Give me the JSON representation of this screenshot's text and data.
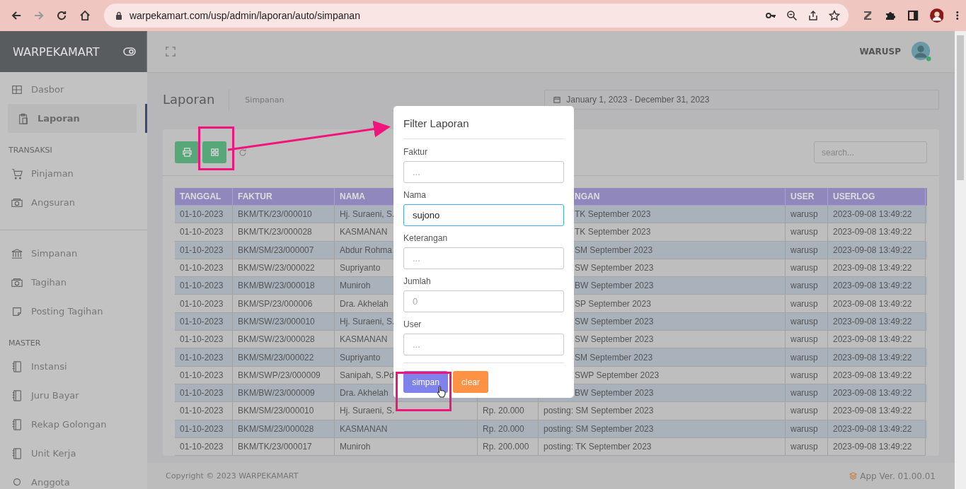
{
  "browser": {
    "url": "warpekamart.com/usp/admin/laporan/auto/simpanan"
  },
  "sidebar": {
    "brand": "WARPEKAMART",
    "sections": [
      {
        "items": [
          {
            "label": "Dasbor",
            "selected": false
          },
          {
            "label": "Laporan",
            "selected": true
          }
        ]
      },
      {
        "heading": "TRANSAKSI",
        "items": [
          {
            "label": "Pinjaman",
            "selected": false
          },
          {
            "label": "Angsuran",
            "selected": false
          }
        ]
      },
      {
        "items": [
          {
            "label": "Simpanan",
            "selected": false
          },
          {
            "label": "Tagihan",
            "selected": false
          },
          {
            "label": "Posting Tagihan",
            "selected": false
          }
        ]
      },
      {
        "heading": "MASTER",
        "items": [
          {
            "label": "Instansi",
            "selected": false
          },
          {
            "label": "Juru Bayar",
            "selected": false
          },
          {
            "label": "Rekap Golongan",
            "selected": false
          },
          {
            "label": "Unit Kerja",
            "selected": false
          },
          {
            "label": "Anggota",
            "selected": false
          }
        ]
      }
    ]
  },
  "header": {
    "user": "WARUSP"
  },
  "page": {
    "title": "Laporan",
    "subtitle": "Simpanan",
    "date_range": "January 1, 2023 - December 31, 2023"
  },
  "search": {
    "placeholder": "search..."
  },
  "table": {
    "columns": [
      {
        "label": "TANGGAL"
      },
      {
        "label": "FAKTUR"
      },
      {
        "label": "NAMA"
      },
      {},
      {
        "label": "NGAN",
        "kind": "partial"
      },
      {
        "label": "USER"
      },
      {
        "label": "USERLOG"
      }
    ],
    "rows": [
      {
        "kind": "partial",
        "cells": [
          "01-10-2023",
          "BKM/TK/23/000010",
          "Hj. Suraeni, S.",
          "",
          "TK September 2023",
          "warusp",
          "2023-09-08 13:49:22"
        ]
      },
      {
        "kind": "partial",
        "cells": [
          "01-10-2023",
          "BKM/TK/23/000028",
          "KASMANAN",
          "",
          "TK September 2023",
          "warusp",
          "2023-09-08 13:49:22"
        ]
      },
      {
        "kind": "partial",
        "cells": [
          "01-10-2023",
          "BKM/SM/23/000007",
          "Abdur Rohma",
          "",
          "SM September 2023",
          "warusp",
          "2023-09-08 13:49:22"
        ]
      },
      {
        "kind": "partial",
        "cells": [
          "01-10-2023",
          "BKM/SW/23/000022",
          "Supriyanto",
          "",
          "SW September 2023",
          "warusp",
          "2023-09-08 13:49:22"
        ]
      },
      {
        "kind": "partial",
        "cells": [
          "01-10-2023",
          "BKM/BW/23/000018",
          "Muniroh",
          "",
          "BW September 2023",
          "warusp",
          "2023-09-08 13:49:22"
        ]
      },
      {
        "kind": "partial",
        "cells": [
          "01-10-2023",
          "BKM/SP/23/000006",
          "Dra. Akhelah",
          "",
          "SP September 2023",
          "warusp",
          "2023-09-08 13:49:22"
        ]
      },
      {
        "kind": "partial",
        "cells": [
          "01-10-2023",
          "BKM/SW/23/000010",
          "Hj. Suraeni, S.",
          "",
          "SW September 2023",
          "warusp",
          "2023-09-08 13:49:22"
        ]
      },
      {
        "kind": "partial",
        "cells": [
          "01-10-2023",
          "BKM/SW/23/000028",
          "KASMANAN",
          "",
          "SW September 2023",
          "warusp",
          "2023-09-08 13:49:22"
        ]
      },
      {
        "kind": "partial",
        "cells": [
          "01-10-2023",
          "BKM/SM/23/000022",
          "Supriyanto",
          "",
          "SM September 2023",
          "warusp",
          "2023-09-08 13:49:22"
        ]
      },
      {
        "kind": "partial",
        "cells": [
          "01-10-2023",
          "BKM/SWP/23/000009",
          "Sanipah, S.Pd",
          "",
          "SWP September 2023",
          "warusp",
          "2023-09-08 13:49:22"
        ]
      },
      {
        "kind": "partial",
        "cells": [
          "01-10-2023",
          "BKM/BW/23/000009",
          "Dra. Akhelah",
          "",
          "BW September 2023",
          "warusp",
          "2023-09-08 13:49:22"
        ]
      },
      {
        "kind": "full",
        "cells": [
          "01-10-2023",
          "BKM/SM/23/000010",
          "Hj. Suraeni, S.",
          "Rp. 20.000",
          "posting: SM September 2023",
          "warusp",
          "2023-09-08 13:49:22"
        ]
      },
      {
        "kind": "full",
        "cells": [
          "01-10-2023",
          "BKM/SM/23/000028",
          "KASMANAN",
          "Rp. 20.000",
          "posting: SM September 2023",
          "warusp",
          "2023-09-08 13:49:22"
        ]
      },
      {
        "kind": "full",
        "cells": [
          "01-10-2023",
          "BKM/TK/23/000017",
          "Muniroh",
          "Rp. 200.000",
          "posting: TK September 2023",
          "warusp",
          "2023-09-08 13:49:22"
        ]
      }
    ]
  },
  "footer": {
    "copyright": "Copyright © 2023 WARPEKAMART",
    "version": "App Ver. 01.00.01"
  },
  "modal": {
    "title": "Filter Laporan",
    "fields": [
      {
        "label": "Faktur",
        "placeholder": "...",
        "focused": false
      },
      {
        "label": "Nama",
        "value": "sujono",
        "focused": true
      },
      {
        "label": "Keterangan",
        "placeholder": "...",
        "focused": false
      },
      {
        "label": "Jumlah",
        "placeholder": "0",
        "focused": false
      },
      {
        "label": "User",
        "placeholder": "...",
        "focused": false
      }
    ],
    "buttons": [
      {
        "label": "simpan",
        "kind": "primary"
      },
      {
        "label": "clear",
        "kind": "warning"
      }
    ]
  }
}
